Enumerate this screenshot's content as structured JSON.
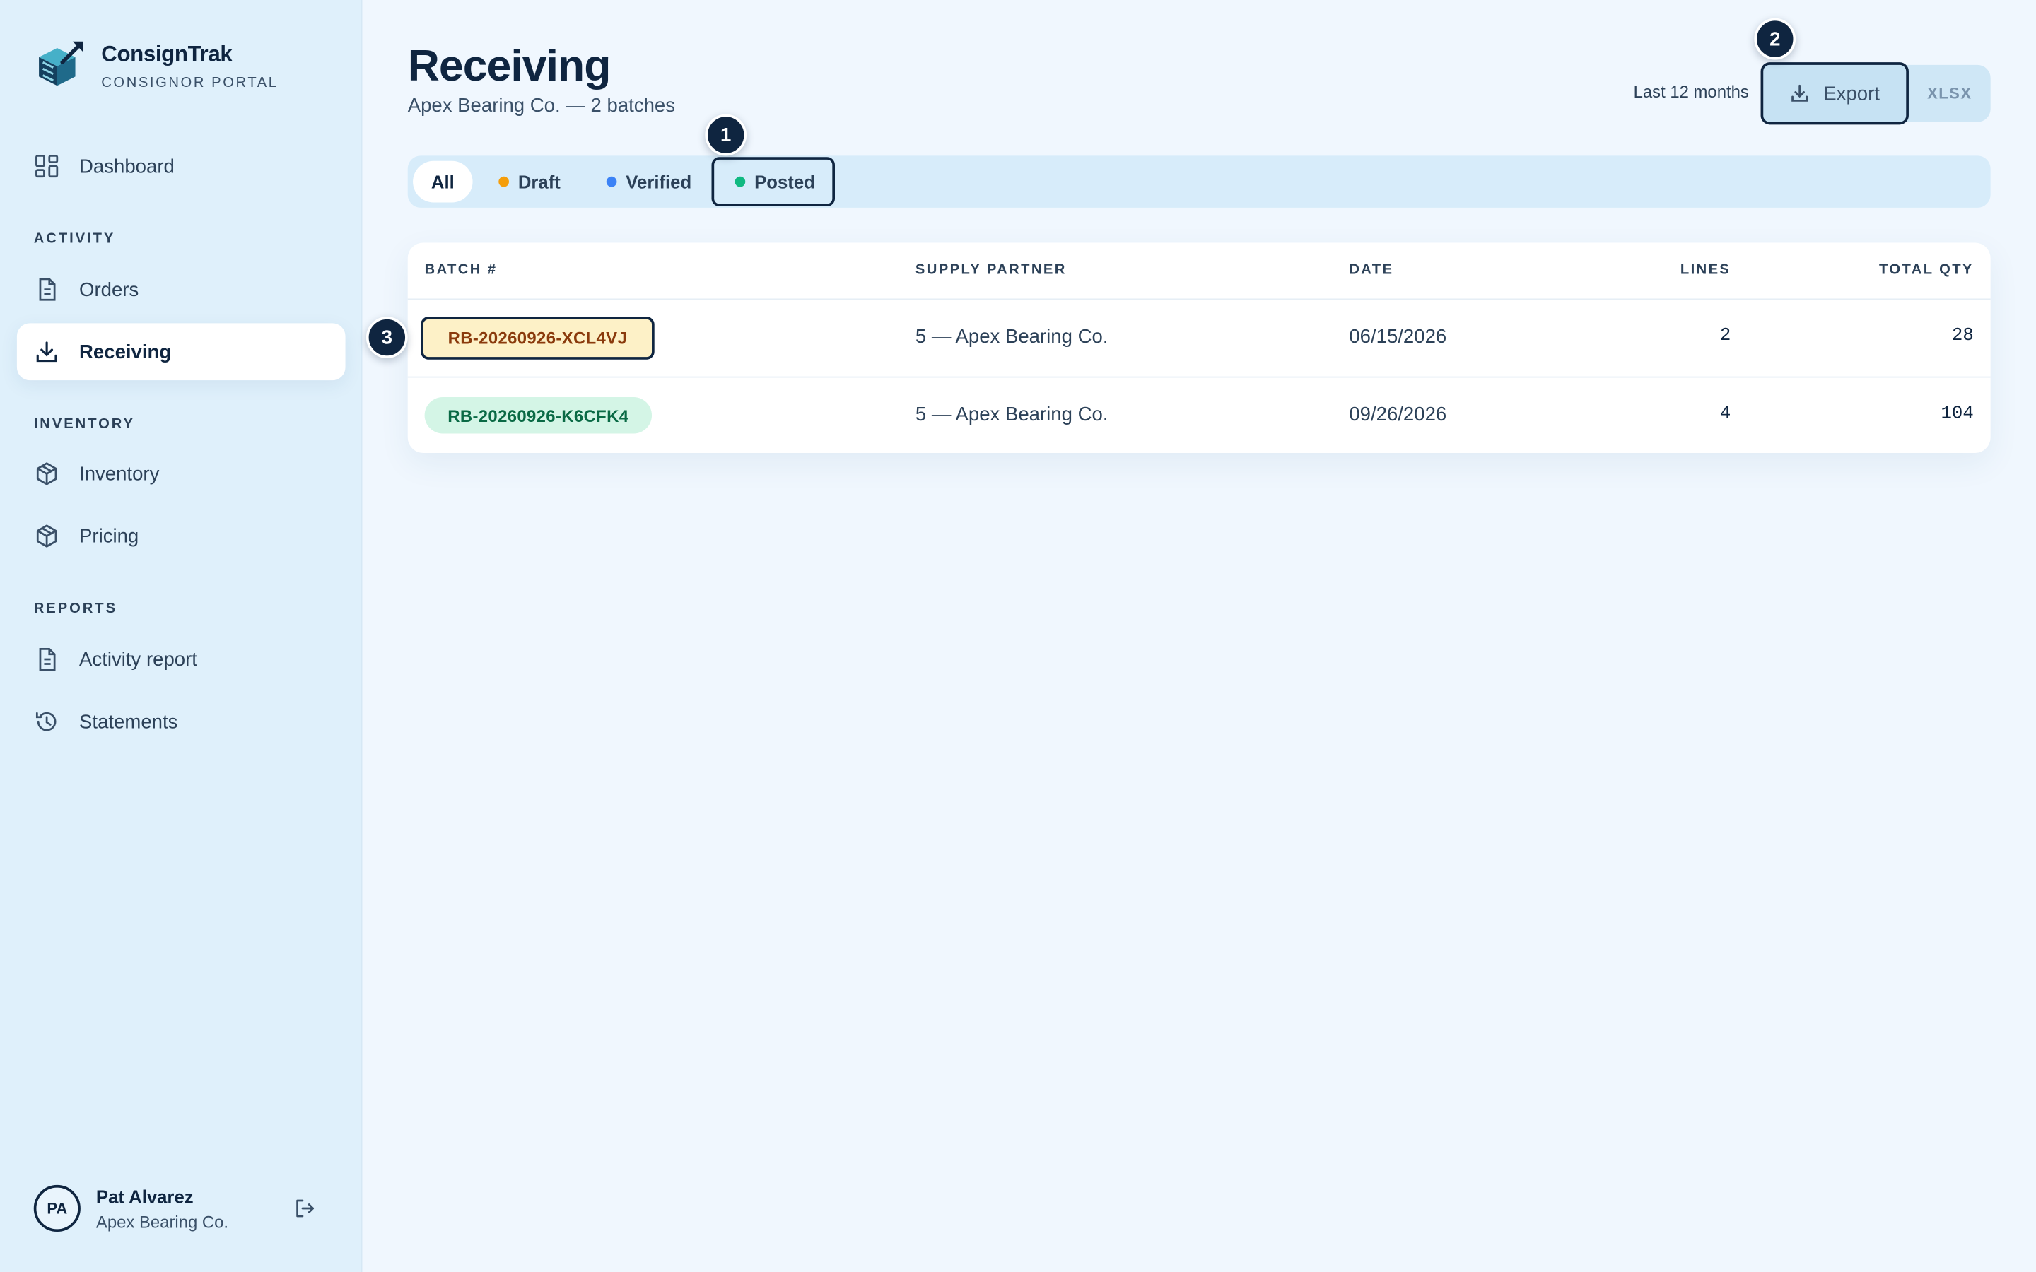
{
  "brand": {
    "name": "ConsignTrak",
    "subtitle": "CONSIGNOR PORTAL"
  },
  "sidebar": {
    "items": [
      {
        "label": "Dashboard",
        "icon": "grid-icon"
      },
      {
        "label": "Orders",
        "icon": "document-icon"
      },
      {
        "label": "Receiving",
        "icon": "download-icon",
        "active": true
      },
      {
        "label": "Inventory",
        "icon": "box-icon"
      },
      {
        "label": "Pricing",
        "icon": "box-icon"
      },
      {
        "label": "Activity report",
        "icon": "document-icon"
      },
      {
        "label": "Statements",
        "icon": "history-icon"
      }
    ],
    "sections": [
      "ACTIVITY",
      "INVENTORY",
      "REPORTS"
    ]
  },
  "user": {
    "initials": "PA",
    "name": "Pat Alvarez",
    "org": "Apex Bearing Co."
  },
  "page": {
    "title": "Receiving",
    "subtitle": "Apex Bearing Co. — 2 batches",
    "range": "Last 12 months",
    "export_label": "Export",
    "format_label": "XLSX"
  },
  "filters": [
    {
      "label": "All",
      "selected": true
    },
    {
      "label": "Draft",
      "color": "#f59e0b"
    },
    {
      "label": "Verified",
      "color": "#3b82f6"
    },
    {
      "label": "Posted",
      "color": "#10b981"
    }
  ],
  "table": {
    "columns": [
      "BATCH #",
      "SUPPLY PARTNER",
      "DATE",
      "LINES",
      "TOTAL QTY"
    ],
    "rows": [
      {
        "batch": "RB-20260926-XCL4VJ",
        "status": "draft",
        "partner": "5 — Apex Bearing Co.",
        "date": "06/15/2026",
        "lines": "2",
        "qty": "28"
      },
      {
        "batch": "RB-20260926-K6CFK4",
        "status": "posted",
        "partner": "5 — Apex Bearing Co.",
        "date": "09/26/2026",
        "lines": "4",
        "qty": "104"
      }
    ]
  },
  "annotations": [
    "1",
    "2",
    "3"
  ],
  "colors": {
    "sidebar_bg": "#dff0fb",
    "main_bg": "#f0f7fe",
    "primary": "#0f2540",
    "draft_chip_bg": "#fdf1c7",
    "draft_chip_text": "#8a3a0c",
    "posted_chip_bg": "#d4f5e6",
    "posted_chip_text": "#0a6a45"
  }
}
